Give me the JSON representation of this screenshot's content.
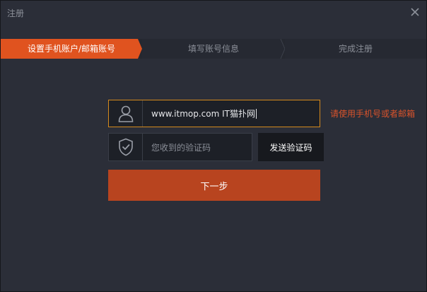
{
  "window": {
    "title": "注册"
  },
  "steps": [
    {
      "label": "设置手机账户/邮箱账号",
      "state": "active"
    },
    {
      "label": "填写账号信息",
      "state": "inactive"
    },
    {
      "label": "完成注册",
      "state": "inactive"
    }
  ],
  "form": {
    "account": {
      "value": "www.itmop.com IT猫扑网",
      "icon": "user-icon"
    },
    "account_hint": "请使用手机号或者邮箱",
    "code": {
      "placeholder": "您收到的验证码",
      "icon": "shield-check-icon"
    },
    "send_code_label": "发送验证码",
    "next_label": "下一步"
  },
  "colors": {
    "accent": "#b8441f",
    "step_active": "#e0531f",
    "focus_border": "#d58a1d",
    "hint": "#d9532b",
    "background": "#2b2e38"
  }
}
